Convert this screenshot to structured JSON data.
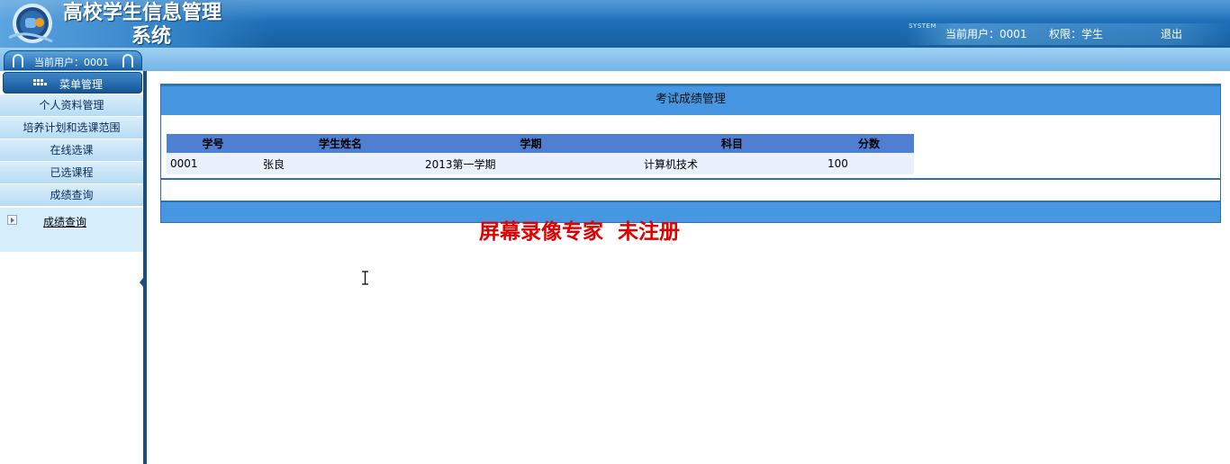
{
  "header": {
    "app_title_line1": "高校学生信息管理",
    "app_title_line2": "系统",
    "system_tag": "SYSTEM",
    "current_user": "当前用户：0001",
    "role": "权限：学生",
    "logout_label": "退出"
  },
  "sidebar": {
    "user_tab": "当前用户：0001",
    "menu_header": "菜单管理",
    "items": [
      {
        "label": "个人资料管理"
      },
      {
        "label": "培养计划和选课范围"
      },
      {
        "label": "在线选课"
      },
      {
        "label": "已选课程"
      },
      {
        "label": "成绩查询"
      }
    ],
    "submenu_link": "成绩查询"
  },
  "main": {
    "panel_title": "考试成绩管理",
    "table": {
      "columns": [
        "学号",
        "学生姓名",
        "学期",
        "科目",
        "分数"
      ],
      "rows": [
        [
          "0001",
          "张良",
          "2013第一学期",
          "计算机技术",
          "100"
        ]
      ]
    }
  },
  "watermark": "屏幕录像专家  未注册",
  "colors": {
    "header_blue": "#1f6fb8",
    "panel_blue": "#4796e2",
    "table_header": "#4f7fd3",
    "table_row": "#eaf1fd",
    "watermark_red": "#e00000"
  }
}
